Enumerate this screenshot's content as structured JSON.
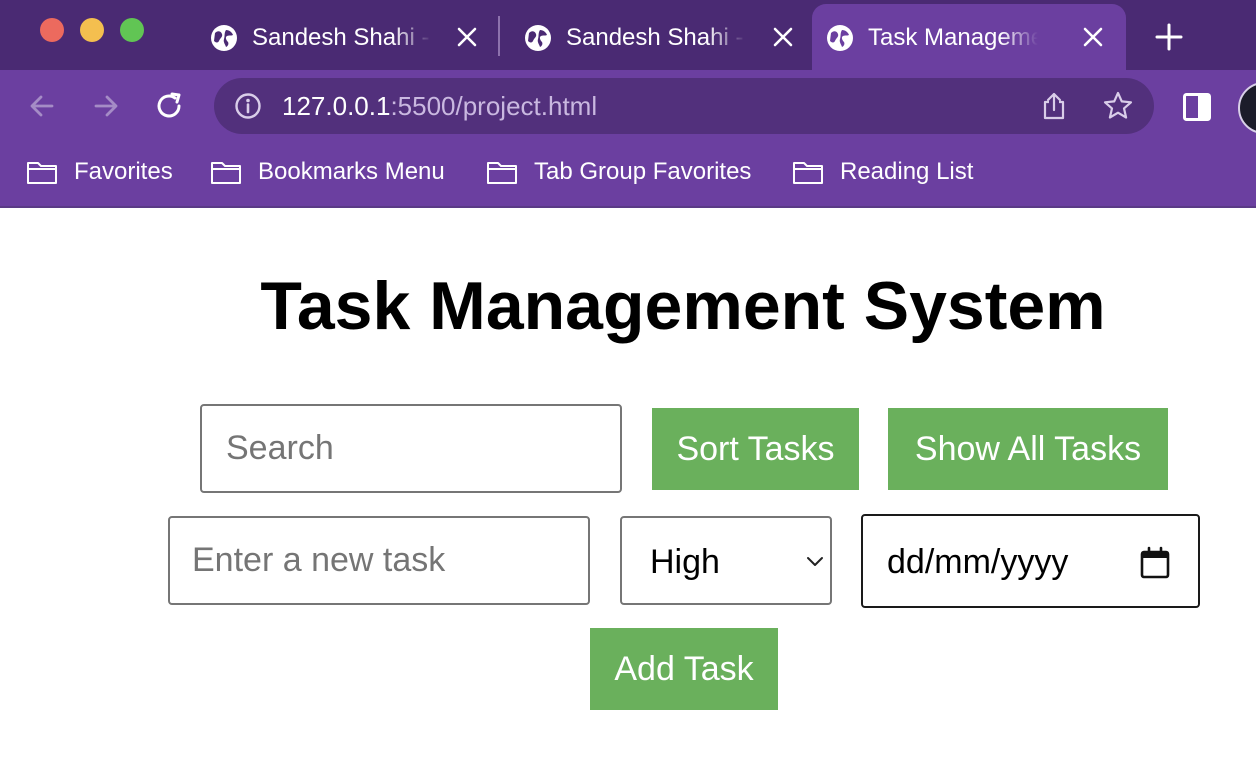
{
  "browser": {
    "tabs": [
      {
        "title": "Sandesh Shahi - ",
        "active": false
      },
      {
        "title": "Sandesh Shahi - ",
        "active": false
      },
      {
        "title": "Task Management System",
        "active": true
      }
    ],
    "new_tab_icon": "plus-icon",
    "url_host": "127.0.0.1",
    "url_rest": ":5500/project.html",
    "bookmarks": [
      "Favorites",
      "Bookmarks Menu",
      "Tab Group Favorites",
      "Reading List"
    ],
    "colors": {
      "tabstrip": "#4a2a73",
      "toolbar": "#6b3fa0",
      "omnibox": "#52307c"
    }
  },
  "page": {
    "title": "Task Management System",
    "search": {
      "placeholder": "Search",
      "value": ""
    },
    "sort_button": "Sort Tasks",
    "show_all_button": "Show All Tasks",
    "task_input": {
      "placeholder": "Enter a new task",
      "value": ""
    },
    "priority": {
      "selected": "High"
    },
    "due_date": {
      "value": "dd/mm/yyyy"
    },
    "add_button": "Add Task",
    "colors": {
      "button": "#6ab05c",
      "button_text": "#ffffff"
    }
  }
}
